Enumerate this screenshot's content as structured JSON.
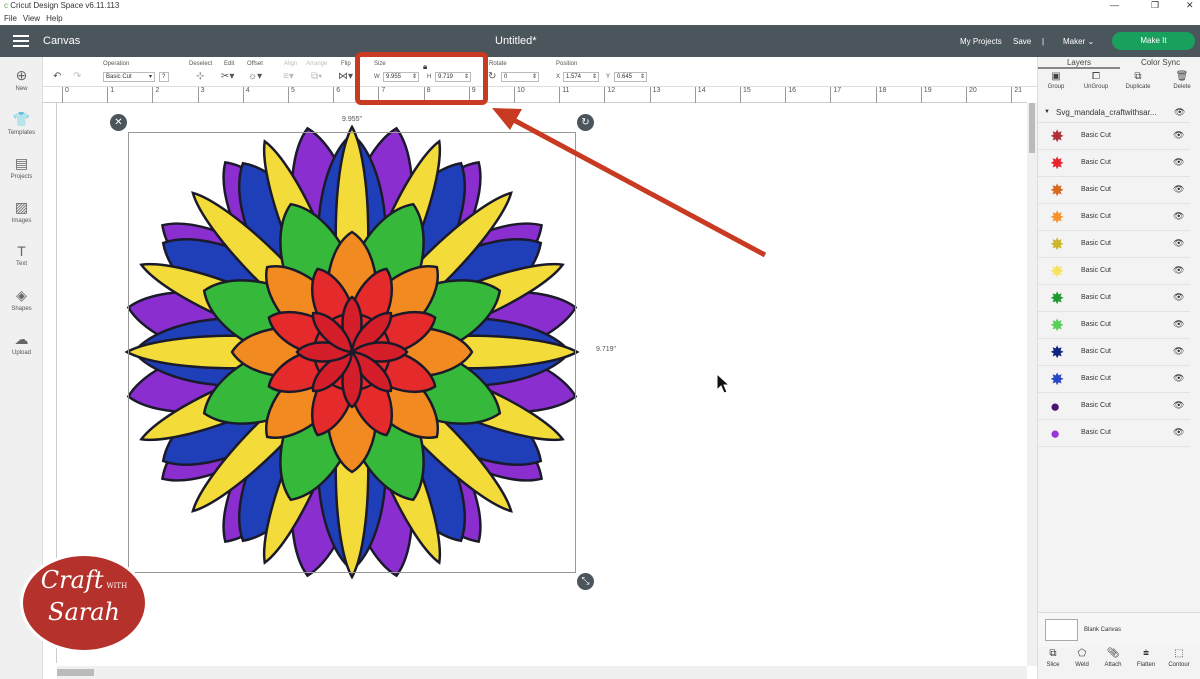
{
  "app": {
    "title": "Cricut Design Space  v6.11.113",
    "menu": [
      "File",
      "View",
      "Help"
    ],
    "window_controls": [
      "—",
      "❐",
      "✕"
    ]
  },
  "header": {
    "section": "Canvas",
    "doc_title": "Untitled*",
    "my_projects": "My Projects",
    "save": "Save",
    "separator": "|",
    "machine": "Maker",
    "make_it": "Make It"
  },
  "toolbar": {
    "operation_label": "Operation",
    "operation_value": "Basic Cut",
    "deselect": "Deselect",
    "edit": "Edit",
    "offset": "Offset",
    "align": "Align",
    "arrange": "Arrange",
    "flip": "Flip",
    "size_label": "Size",
    "w_label": "W",
    "w_value": "9.955",
    "h_label": "H",
    "h_value": "9.719",
    "rotate_label": "Rotate",
    "rotate_value": "0",
    "position_label": "Position",
    "x_label": "X",
    "x_value": "1.574",
    "y_label": "Y",
    "y_value": "0.645",
    "help": "?"
  },
  "ruler": {
    "ticks": [
      "0",
      "1",
      "2",
      "3",
      "4",
      "5",
      "6",
      "7",
      "8",
      "9",
      "10",
      "11",
      "12",
      "13",
      "14",
      "15",
      "16",
      "17",
      "18",
      "19",
      "20",
      "21"
    ]
  },
  "sidebar": {
    "items": [
      {
        "label": "New"
      },
      {
        "label": "Templates"
      },
      {
        "label": "Projects"
      },
      {
        "label": "Images"
      },
      {
        "label": "Text"
      },
      {
        "label": "Shapes"
      },
      {
        "label": "Upload"
      }
    ]
  },
  "canvas": {
    "width_readout": "9.955\"",
    "height_readout": "9.719\""
  },
  "panel": {
    "tabs": [
      "Layers",
      "Color Sync"
    ],
    "actions": [
      "Group",
      "UnGroup",
      "Duplicate",
      "Delete"
    ],
    "group_name": "Svg_mandala_craftwithsar...",
    "layers": [
      {
        "name": "Basic Cut",
        "color": "#b0303a"
      },
      {
        "name": "Basic Cut",
        "color": "#e8232f"
      },
      {
        "name": "Basic Cut",
        "color": "#d9671e"
      },
      {
        "name": "Basic Cut",
        "color": "#f7932a"
      },
      {
        "name": "Basic Cut",
        "color": "#cbb52a"
      },
      {
        "name": "Basic Cut",
        "color": "#f5e462"
      },
      {
        "name": "Basic Cut",
        "color": "#1f9a33"
      },
      {
        "name": "Basic Cut",
        "color": "#57d057"
      },
      {
        "name": "Basic Cut",
        "color": "#11237d"
      },
      {
        "name": "Basic Cut",
        "color": "#2747c8"
      },
      {
        "name": "Basic Cut",
        "color": "#4a1670"
      },
      {
        "name": "Basic Cut",
        "color": "#9a36d8"
      }
    ],
    "blank_canvas": "Blank Canvas",
    "bottom_actions": [
      "Slice",
      "Weld",
      "Attach",
      "Flatten",
      "Contour"
    ]
  },
  "watermark": {
    "line1": "Craft",
    "line2": "WITH",
    "line3": "Sarah"
  },
  "colors": {
    "header": "#4b555c",
    "make_it": "#1aa05d",
    "annotation": "#c83a22",
    "purple": "#8a2ed0",
    "blue": "#1f3fb8",
    "yellow": "#f3dc3a",
    "green": "#36b83a",
    "orange": "#f28a22",
    "red": "#e42a2a"
  }
}
